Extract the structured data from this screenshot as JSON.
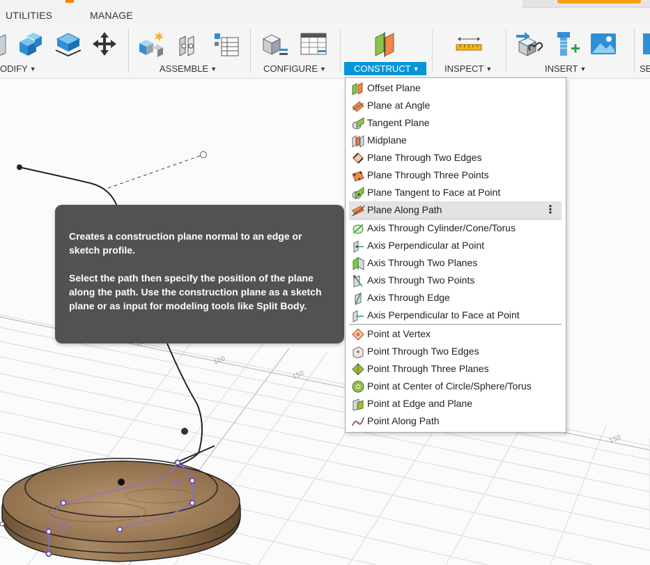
{
  "tabs": {
    "utilities": "UTILITIES",
    "manage": "MANAGE"
  },
  "toolbar": {
    "groups": [
      {
        "label": "ODIFY",
        "caret": "▼"
      },
      {
        "label": "ASSEMBLE",
        "caret": "▼"
      },
      {
        "label": "CONFIGURE",
        "caret": "▼"
      },
      {
        "label": "CONSTRUCT",
        "caret": "▼"
      },
      {
        "label": "INSPECT",
        "caret": "▼"
      },
      {
        "label": "INSERT",
        "caret": "▼"
      },
      {
        "label": "SE"
      }
    ]
  },
  "menu": {
    "items": [
      {
        "label": "Offset Plane",
        "icon": "offset-plane-icon"
      },
      {
        "label": "Plane at Angle",
        "icon": "plane-at-angle-icon"
      },
      {
        "label": "Tangent Plane",
        "icon": "tangent-plane-icon"
      },
      {
        "label": "Midplane",
        "icon": "midplane-icon"
      },
      {
        "label": "Plane Through Two Edges",
        "icon": "plane-two-edges-icon"
      },
      {
        "label": "Plane Through Three Points",
        "icon": "plane-three-points-icon"
      },
      {
        "label": "Plane Tangent to Face at Point",
        "icon": "plane-tangent-face-icon"
      },
      {
        "label": "Plane Along Path",
        "icon": "plane-along-path-icon",
        "more": "⋮"
      },
      {
        "label": "Axis Through Cylinder/Cone/Torus",
        "icon": "axis-cylinder-icon"
      },
      {
        "label": "Axis Perpendicular at Point",
        "icon": "axis-perpendicular-point-icon"
      },
      {
        "label": "Axis Through Two Planes",
        "icon": "axis-two-planes-icon"
      },
      {
        "label": "Axis Through Two Points",
        "icon": "axis-two-points-icon"
      },
      {
        "label": "Axis Through Edge",
        "icon": "axis-edge-icon"
      },
      {
        "label": "Axis Perpendicular to Face at Point",
        "icon": "axis-perpendicular-face-icon"
      },
      {
        "label": "Point at Vertex",
        "icon": "point-vertex-icon"
      },
      {
        "label": "Point Through Two Edges",
        "icon": "point-two-edges-icon"
      },
      {
        "label": "Point Through Three Planes",
        "icon": "point-three-planes-icon"
      },
      {
        "label": "Point at Center of Circle/Sphere/Torus",
        "icon": "point-center-icon"
      },
      {
        "label": "Point at Edge and Plane",
        "icon": "point-edge-plane-icon"
      },
      {
        "label": "Point Along Path",
        "icon": "point-along-path-icon"
      }
    ]
  },
  "tooltip": {
    "paragraph1": "Creates a construction plane normal to an edge or sketch profile.",
    "paragraph2": "Select the path then specify the position of the plane along the path. Use the construction plane as a sketch plane or as input for modeling tools like Split Body."
  },
  "canvas": {
    "grid_labels": [
      "150",
      "100",
      "150",
      "150"
    ]
  },
  "colors": {
    "accent": "#0696d7",
    "tooltip_bg": "#525252",
    "menu_highlight": "#e3e3e3",
    "orange": "#f5a016",
    "sketch_profile": "#8e6bd8",
    "wood": "#9c7a55"
  }
}
